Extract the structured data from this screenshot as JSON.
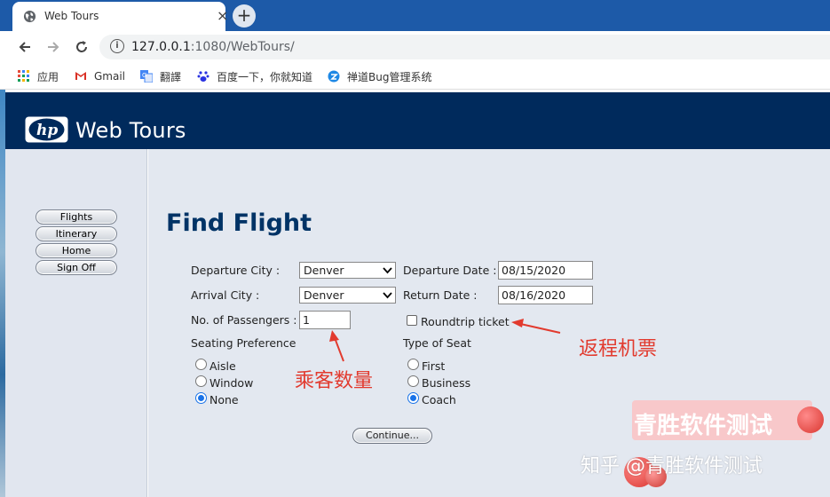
{
  "browser": {
    "tab_title": "Web Tours",
    "tab_close": "×",
    "new_tab": "+",
    "url_host": "127.0.0.1",
    "url_rest": ":1080/WebTours/",
    "bookmarks": [
      "应用",
      "Gmail",
      "翻譯",
      "百度一下，你就知道",
      "禅道Bug管理系统"
    ]
  },
  "banner": {
    "brand": "Web Tours",
    "logo_text": "hp"
  },
  "sidebar": {
    "items": [
      "Flights",
      "Itinerary",
      "Home",
      "Sign Off"
    ]
  },
  "form": {
    "title": "Find Flight",
    "departure_city_label": "Departure City :",
    "departure_city_value": "Denver",
    "departure_date_label": "Departure Date :",
    "departure_date_value": "08/15/2020",
    "arrival_city_label": "Arrival City :",
    "arrival_city_value": "Denver",
    "return_date_label": "Return Date :",
    "return_date_value": "08/16/2020",
    "passengers_label": "No. of Passengers :",
    "passengers_value": "1",
    "roundtrip_label": "Roundtrip ticket",
    "roundtrip_checked": false,
    "seating_label": "Seating Preference",
    "seating_options": [
      "Aisle",
      "Window",
      "None"
    ],
    "seating_selected": "None",
    "seat_type_label": "Type of Seat",
    "seat_type_options": [
      "First",
      "Business",
      "Coach"
    ],
    "seat_type_selected": "Coach",
    "continue_label": "Continue..."
  },
  "annotations": {
    "return_ticket": "返程机票",
    "passenger_count": "乘客数量",
    "watermark_main": "青胜软件测试",
    "watermark_credit": "知乎 @青胜软件测试"
  },
  "colors": {
    "banner": "#002a5c",
    "title": "#003366",
    "annotation": "#e23a2e"
  }
}
